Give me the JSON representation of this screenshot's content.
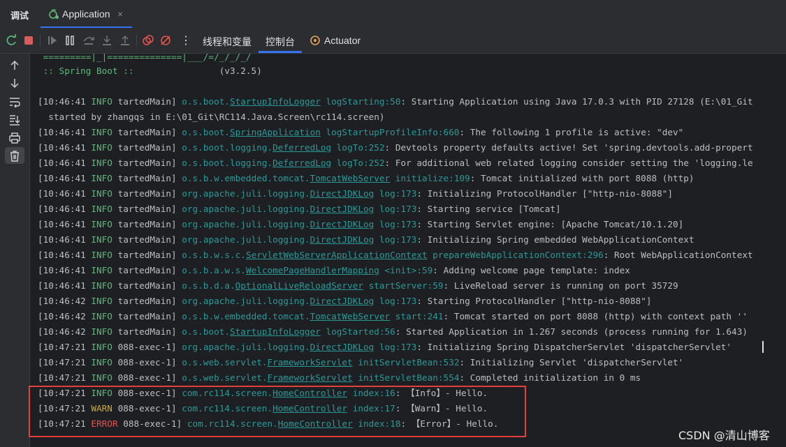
{
  "topbar": {
    "debug_label": "调试",
    "app_tab_label": "Application",
    "app_tab_close": "×"
  },
  "toolbar": {
    "tab_threads": "线程和变量",
    "tab_console": "控制台",
    "tab_actuator": "Actuator",
    "more": "⋮"
  },
  "console": {
    "banner_line1": " =========|_|==============|___/=/_/_/_/",
    "banner_line2_label": " :: Spring Boot :: ",
    "banner_line2_version": "               (v3.2.5)",
    "lines": [
      {
        "ts": "[10:46:41 ",
        "level": "INFO",
        "thread": " tartedMain] ",
        "pkg": "o.s.boot.",
        "cls": "StartupInfoLogger",
        "method": " logStarting:50",
        "msg": ": Starting Application using Java 17.0.3 with PID 27128 (E:\\01_Git"
      },
      {
        "cont": "  started by zhangqs in E:\\01_Git\\RC114.Java.Screen\\rc114.screen)"
      },
      {
        "ts": "[10:46:41 ",
        "level": "INFO",
        "thread": " tartedMain] ",
        "pkg": "o.s.boot.",
        "cls": "SpringApplication",
        "method": " logStartupProfileInfo:660",
        "msg": ": The following 1 profile is active: \"dev\""
      },
      {
        "ts": "[10:46:41 ",
        "level": "INFO",
        "thread": " tartedMain] ",
        "pkg": "o.s.boot.logging.",
        "cls": "DeferredLog",
        "method": " logTo:252",
        "msg": ": Devtools property defaults active! Set 'spring.devtools.add-propert"
      },
      {
        "ts": "[10:46:41 ",
        "level": "INFO",
        "thread": " tartedMain] ",
        "pkg": "o.s.boot.logging.",
        "cls": "DeferredLog",
        "method": " logTo:252",
        "msg": ": For additional web related logging consider setting the 'logging.le"
      },
      {
        "ts": "[10:46:41 ",
        "level": "INFO",
        "thread": " tartedMain] ",
        "pkg": "o.s.b.w.embedded.tomcat.",
        "cls": "TomcatWebServer",
        "method": " initialize:109",
        "msg": ": Tomcat initialized with port 8088 (http)"
      },
      {
        "ts": "[10:46:41 ",
        "level": "INFO",
        "thread": " tartedMain] ",
        "pkg": "org.apache.juli.logging.",
        "cls": "DirectJDKLog",
        "method": " log:173",
        "msg": ": Initializing ProtocolHandler [\"http-nio-8088\"]"
      },
      {
        "ts": "[10:46:41 ",
        "level": "INFO",
        "thread": " tartedMain] ",
        "pkg": "org.apache.juli.logging.",
        "cls": "DirectJDKLog",
        "method": " log:173",
        "msg": ": Starting service [Tomcat]"
      },
      {
        "ts": "[10:46:41 ",
        "level": "INFO",
        "thread": " tartedMain] ",
        "pkg": "org.apache.juli.logging.",
        "cls": "DirectJDKLog",
        "method": " log:173",
        "msg": ": Starting Servlet engine: [Apache Tomcat/10.1.20]"
      },
      {
        "ts": "[10:46:41 ",
        "level": "INFO",
        "thread": " tartedMain] ",
        "pkg": "org.apache.juli.logging.",
        "cls": "DirectJDKLog",
        "method": " log:173",
        "msg": ": Initializing Spring embedded WebApplicationContext"
      },
      {
        "ts": "[10:46:41 ",
        "level": "INFO",
        "thread": " tartedMain] ",
        "pkg": "o.s.b.w.s.c.",
        "cls": "ServletWebServerApplicationContext",
        "method": " prepareWebApplicationContext:296",
        "msg": ": Root WebApplicationContext"
      },
      {
        "ts": "[10:46:41 ",
        "level": "INFO",
        "thread": " tartedMain] ",
        "pkg": "o.s.b.a.w.s.",
        "cls": "WelcomePageHandlerMapping",
        "method": " <init>:59",
        "msg": ": Adding welcome page template: index"
      },
      {
        "ts": "[10:46:41 ",
        "level": "INFO",
        "thread": " tartedMain] ",
        "pkg": "o.s.b.d.a.",
        "cls": "OptionalLiveReloadServer",
        "method": " startServer:59",
        "msg": ": LiveReload server is running on port 35729"
      },
      {
        "ts": "[10:46:42 ",
        "level": "INFO",
        "thread": " tartedMain] ",
        "pkg": "org.apache.juli.logging.",
        "cls": "DirectJDKLog",
        "method": " log:173",
        "msg": ": Starting ProtocolHandler [\"http-nio-8088\"]"
      },
      {
        "ts": "[10:46:42 ",
        "level": "INFO",
        "thread": " tartedMain] ",
        "pkg": "o.s.b.w.embedded.tomcat.",
        "cls": "TomcatWebServer",
        "method": " start:241",
        "msg": ": Tomcat started on port 8088 (http) with context path ''"
      },
      {
        "ts": "[10:46:42 ",
        "level": "INFO",
        "thread": " tartedMain] ",
        "pkg": "o.s.boot.",
        "cls": "StartupInfoLogger",
        "method": " logStarted:56",
        "msg": ": Started Application in 1.267 seconds (process running for 1.643)"
      },
      {
        "ts": "[10:47:21 ",
        "level": "INFO",
        "thread": " 088-exec-1] ",
        "pkg": "org.apache.juli.logging.",
        "cls": "DirectJDKLog",
        "method": " log:173",
        "msg": ": Initializing Spring DispatcherServlet 'dispatcherServlet'"
      },
      {
        "ts": "[10:47:21 ",
        "level": "INFO",
        "thread": " 088-exec-1] ",
        "pkg": "o.s.web.servlet.",
        "cls": "FrameworkServlet",
        "method": " initServletBean:532",
        "msg": ": Initializing Servlet 'dispatcherServlet'"
      },
      {
        "ts": "[10:47:21 ",
        "level": "INFO",
        "thread": " 088-exec-1] ",
        "pkg": "o.s.web.servlet.",
        "cls": "FrameworkServlet",
        "method": " initServletBean:554",
        "msg": ": Completed initialization in 0 ms"
      },
      {
        "ts": "[10:47:21 ",
        "level": "INFO",
        "thread": " 088-exec-1] ",
        "pkg": "com.rc114.screen.",
        "cls": "HomeController",
        "method": " index:16",
        "msg": ": 【Info】- Hello."
      },
      {
        "ts": "[10:47:21 ",
        "level": "WARN",
        "thread": " 088-exec-1] ",
        "pkg": "com.rc114.screen.",
        "cls": "HomeController",
        "method": " index:17",
        "msg": ": 【Warn】- Hello."
      },
      {
        "ts": "[10:47:21 ",
        "level": "ERROR",
        "thread": " 088-exec-1] ",
        "pkg": "com.rc114.screen.",
        "cls": "HomeController",
        "method": " index:18",
        "msg": ": 【Error】- Hello."
      }
    ]
  },
  "watermark": "CSDN @清山博客",
  "colors": {
    "accent": "#3574f0",
    "info": "#5fb87b",
    "warn": "#c9a83d",
    "error": "#e5534b",
    "highlight": "#e0413a",
    "class_link": "#299999"
  },
  "icons": {
    "sidebar": [
      "arrow-up-icon",
      "arrow-down-icon",
      "soft-wrap-icon",
      "scroll-to-end-icon",
      "print-icon",
      "trash-icon"
    ],
    "toolbar": [
      "rerun-icon",
      "stop-icon",
      "resume-icon",
      "pause-icon",
      "step-over-icon",
      "step-into-icon",
      "step-out-icon",
      "view-breakpoints-icon",
      "mute-breakpoints-icon",
      "more-icon",
      "actuator-icon"
    ]
  }
}
